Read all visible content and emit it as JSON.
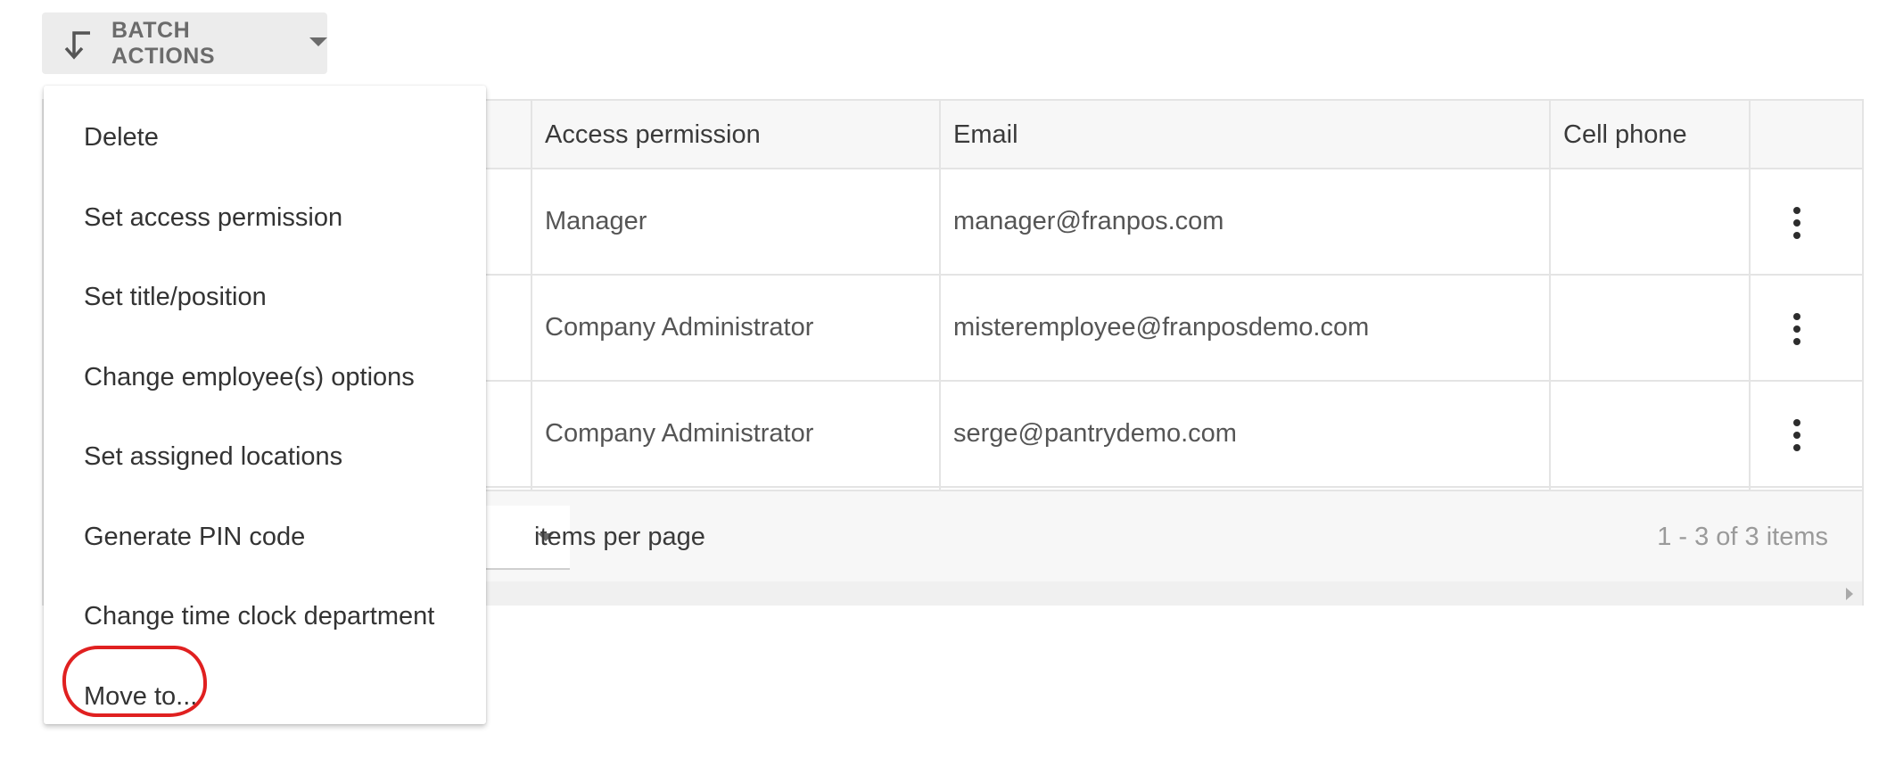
{
  "batch_button": {
    "label": "BATCH ACTIONS",
    "icon": "down-left-arrow-icon"
  },
  "menu": {
    "items": [
      {
        "label": "Delete"
      },
      {
        "label": "Set access permission"
      },
      {
        "label": "Set title/position"
      },
      {
        "label": "Change employee(s) options"
      },
      {
        "label": "Set assigned locations"
      },
      {
        "label": "Generate PIN code"
      },
      {
        "label": "Change time clock department"
      },
      {
        "label": "Move to..."
      }
    ],
    "highlighted_item": "Move to...",
    "highlight_color": "#e02020"
  },
  "table": {
    "columns": [
      "Access permission",
      "Email",
      "Cell phone"
    ],
    "rows": [
      {
        "access": "Manager",
        "email": "manager@franpos.com",
        "cell": ""
      },
      {
        "access": "Company Administrator",
        "email": "misteremployee@franposdemo.com",
        "cell": ""
      },
      {
        "access": "Company Administrator",
        "email": "serge@pantrydemo.com",
        "cell": ""
      }
    ],
    "row_action_icon": "more-vert-icon"
  },
  "footer": {
    "per_page_label": "items per page",
    "pager_info": "1 - 3 of 3 items"
  }
}
